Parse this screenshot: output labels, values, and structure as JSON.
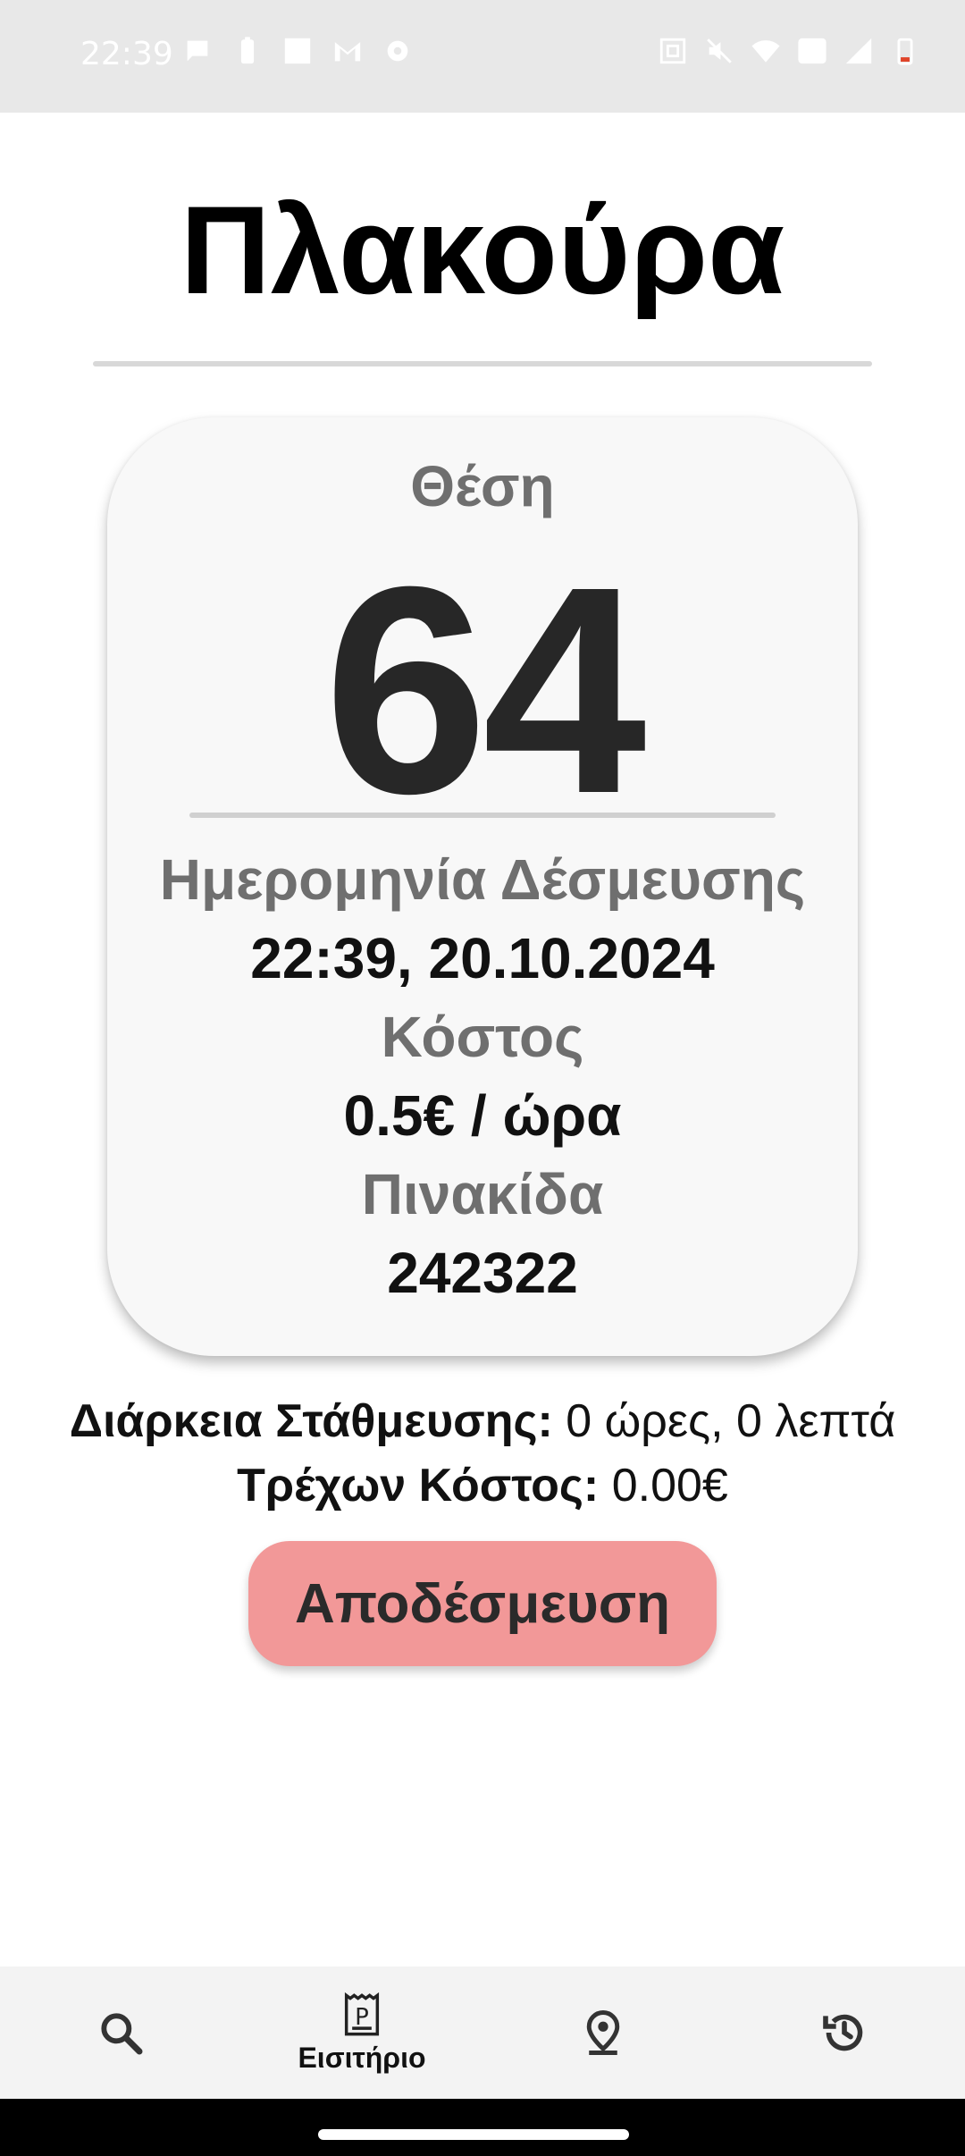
{
  "status_bar": {
    "time": "22:39",
    "left_icons": [
      "chat-bubble-icon",
      "battery-saver-icon",
      "square-notification-icon",
      "gmail-icon",
      "settings-gear-icon"
    ],
    "right_icons": [
      "nfc-icon",
      "mute-icon",
      "wifi-icon",
      "lte-icon",
      "signal-icon",
      "battery-low-icon"
    ]
  },
  "header": {
    "title": "Πλακούρα"
  },
  "ticket": {
    "spot_label": "Θέση",
    "spot_number": "64",
    "date_label": "Ημερομηνία Δέσμευσης",
    "date_value": "22:39, 20.10.2024",
    "cost_label": "Κόστος",
    "cost_value": "0.5€ / ώρα",
    "plate_label": "Πινακίδα",
    "plate_value": "242322"
  },
  "summary": {
    "duration_label": "Διάρκεια Στάθμευσης:",
    "duration_value": "0 ώρες, 0 λεπτά",
    "current_cost_label": "Τρέχων Κόστος:",
    "current_cost_value": "0.00€"
  },
  "actions": {
    "release_label": "Αποδέσμευση"
  },
  "colors": {
    "release_button": "#f29898",
    "card_bg": "#f8f8f8",
    "label_gray": "#6f6f6f"
  },
  "nav": {
    "items": [
      {
        "icon": "search-icon",
        "label": ""
      },
      {
        "icon": "parking-ticket-icon",
        "label": "Εισιτήριο",
        "active": true
      },
      {
        "icon": "location-pin-icon",
        "label": ""
      },
      {
        "icon": "history-icon",
        "label": ""
      }
    ]
  }
}
